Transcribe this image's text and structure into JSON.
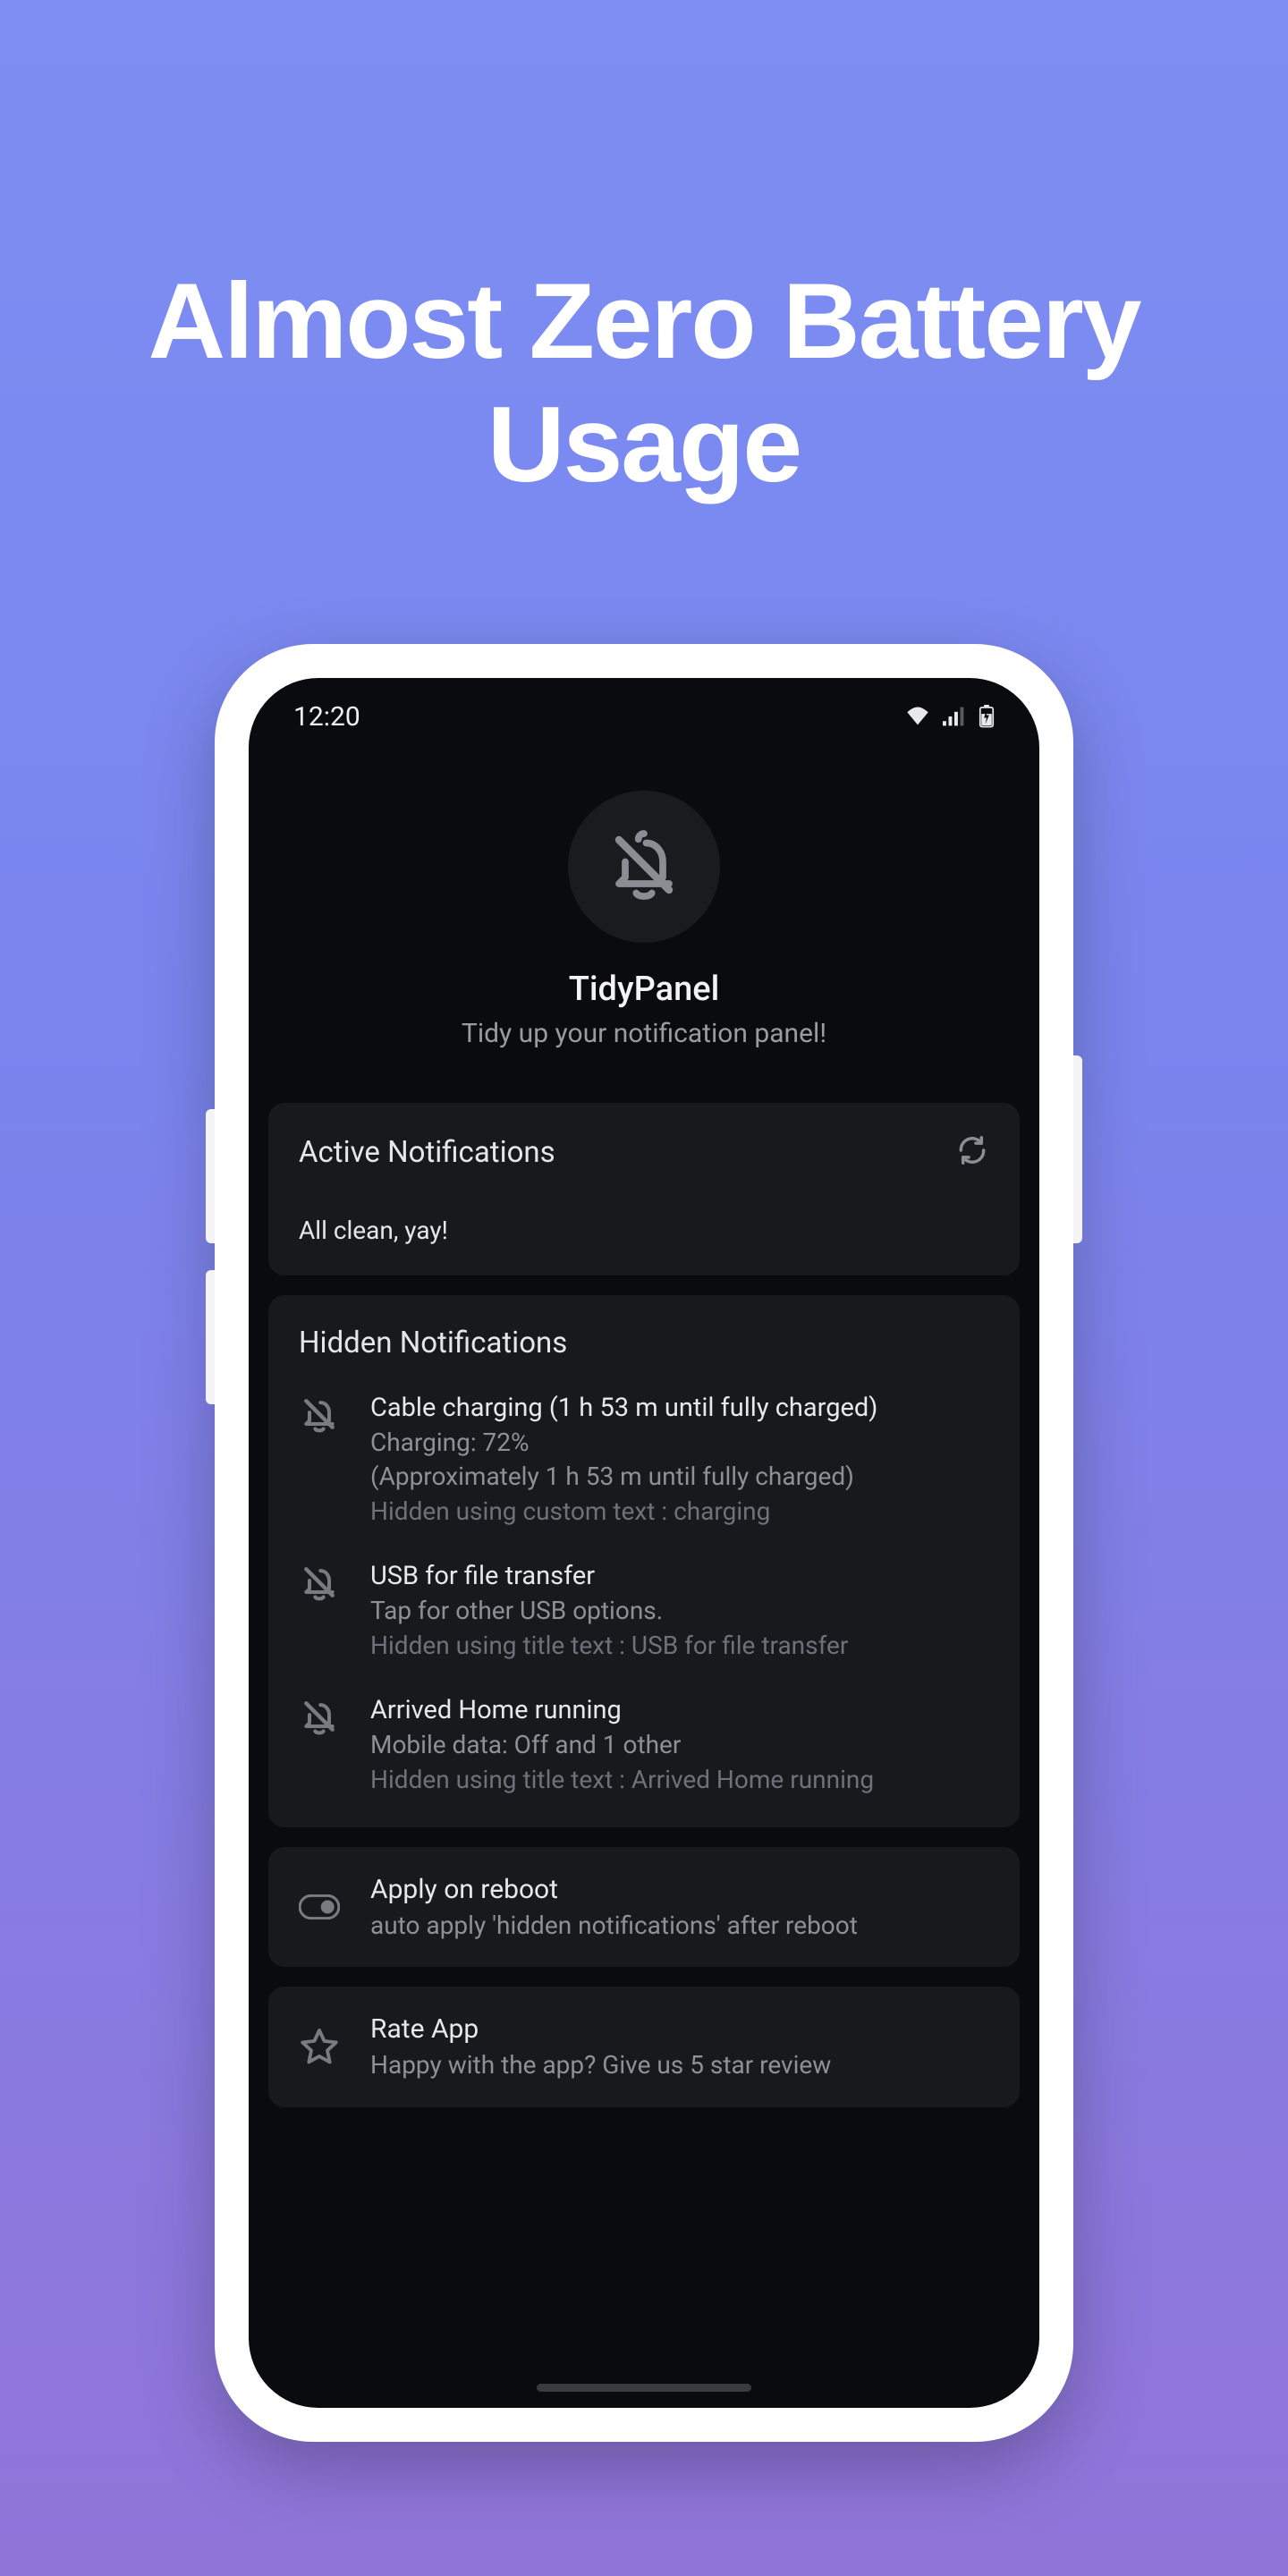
{
  "headline": "Almost Zero Battery Usage",
  "statusbar": {
    "time": "12:20",
    "icons": {
      "wifi": "wifi-icon",
      "signal": "signal-icon",
      "battery": "battery-charging-icon"
    }
  },
  "app": {
    "title": "TidyPanel",
    "subtitle": "Tidy up your notification panel!",
    "header_icon": "bell-off-icon"
  },
  "active": {
    "title": "Active Notifications",
    "refresh_icon": "refresh-icon",
    "empty_text": "All clean, yay!"
  },
  "hidden": {
    "title": "Hidden Notifications",
    "items": [
      {
        "icon": "bell-off-icon",
        "title": "Cable charging (1 h 53 m until fully charged)",
        "subtitle": "Charging: 72%",
        "subtitle2": "(Approximately 1 h 53 m until fully charged)",
        "rule": "Hidden using custom text : charging"
      },
      {
        "icon": "bell-off-icon",
        "title": "USB for file transfer",
        "subtitle": "Tap for other USB options.",
        "subtitle2": "",
        "rule": "Hidden using title text : USB for file transfer"
      },
      {
        "icon": "bell-off-icon",
        "title": "Arrived Home running",
        "subtitle": "Mobile data: Off and 1 other",
        "subtitle2": "",
        "rule": "Hidden using title text : Arrived Home running"
      }
    ]
  },
  "settings": {
    "apply_on_reboot": {
      "icon": "toggle-icon",
      "title": "Apply on reboot",
      "subtitle": "auto apply 'hidden notifications' after reboot"
    },
    "rate_app": {
      "icon": "star-icon",
      "title": "Rate App",
      "subtitle": "Happy with the app? Give us 5 star review"
    }
  }
}
